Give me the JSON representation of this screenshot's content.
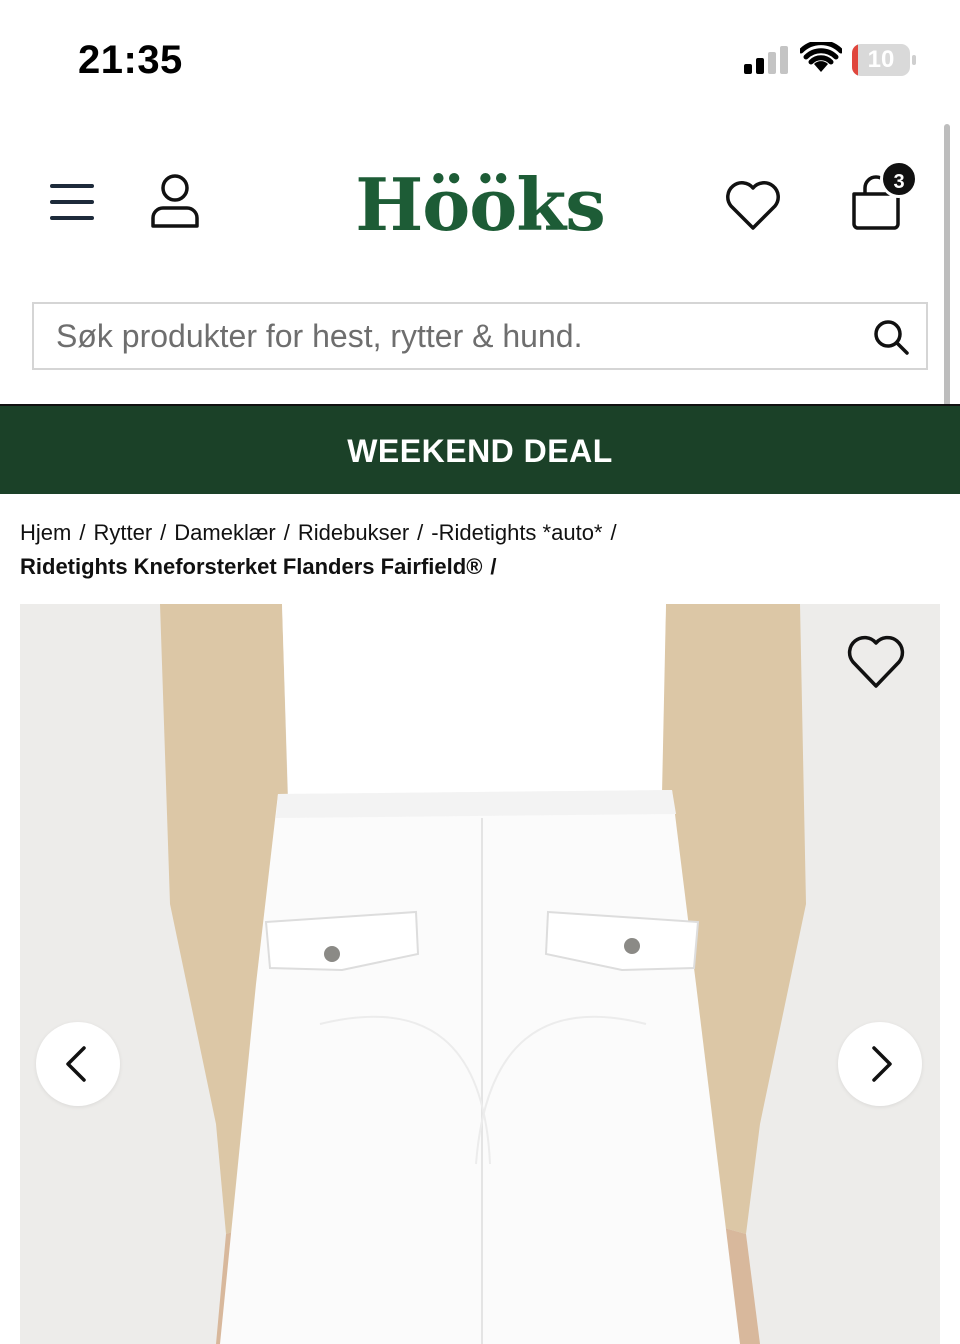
{
  "status_bar": {
    "time": "21:35",
    "battery_level": "10",
    "battery_color": "#e0463d",
    "icons": [
      "signal-icon",
      "wifi-icon",
      "battery-icon"
    ]
  },
  "header": {
    "logo": "Hööks",
    "logo_color": "#1d5c36",
    "cart_count": "3",
    "icons": [
      "menu-icon",
      "account-icon",
      "heart-icon",
      "cart-icon"
    ]
  },
  "search": {
    "placeholder": "Søk produkter for hest, rytter & hund.",
    "value": "",
    "icon": "search-icon"
  },
  "promo": {
    "text": "WEEKEND DEAL",
    "background": "#1b4128"
  },
  "breadcrumb": {
    "items": [
      "Hjem",
      "Rytter",
      "Dameklær",
      "Ridebukser",
      "-Ridetights *auto*"
    ],
    "separator": "/",
    "current": "Ridetights Kneforsterket Flanders Fairfield®"
  },
  "product_image": {
    "icons": [
      "heart-icon",
      "chevron-left-icon",
      "chevron-right-icon"
    ]
  }
}
